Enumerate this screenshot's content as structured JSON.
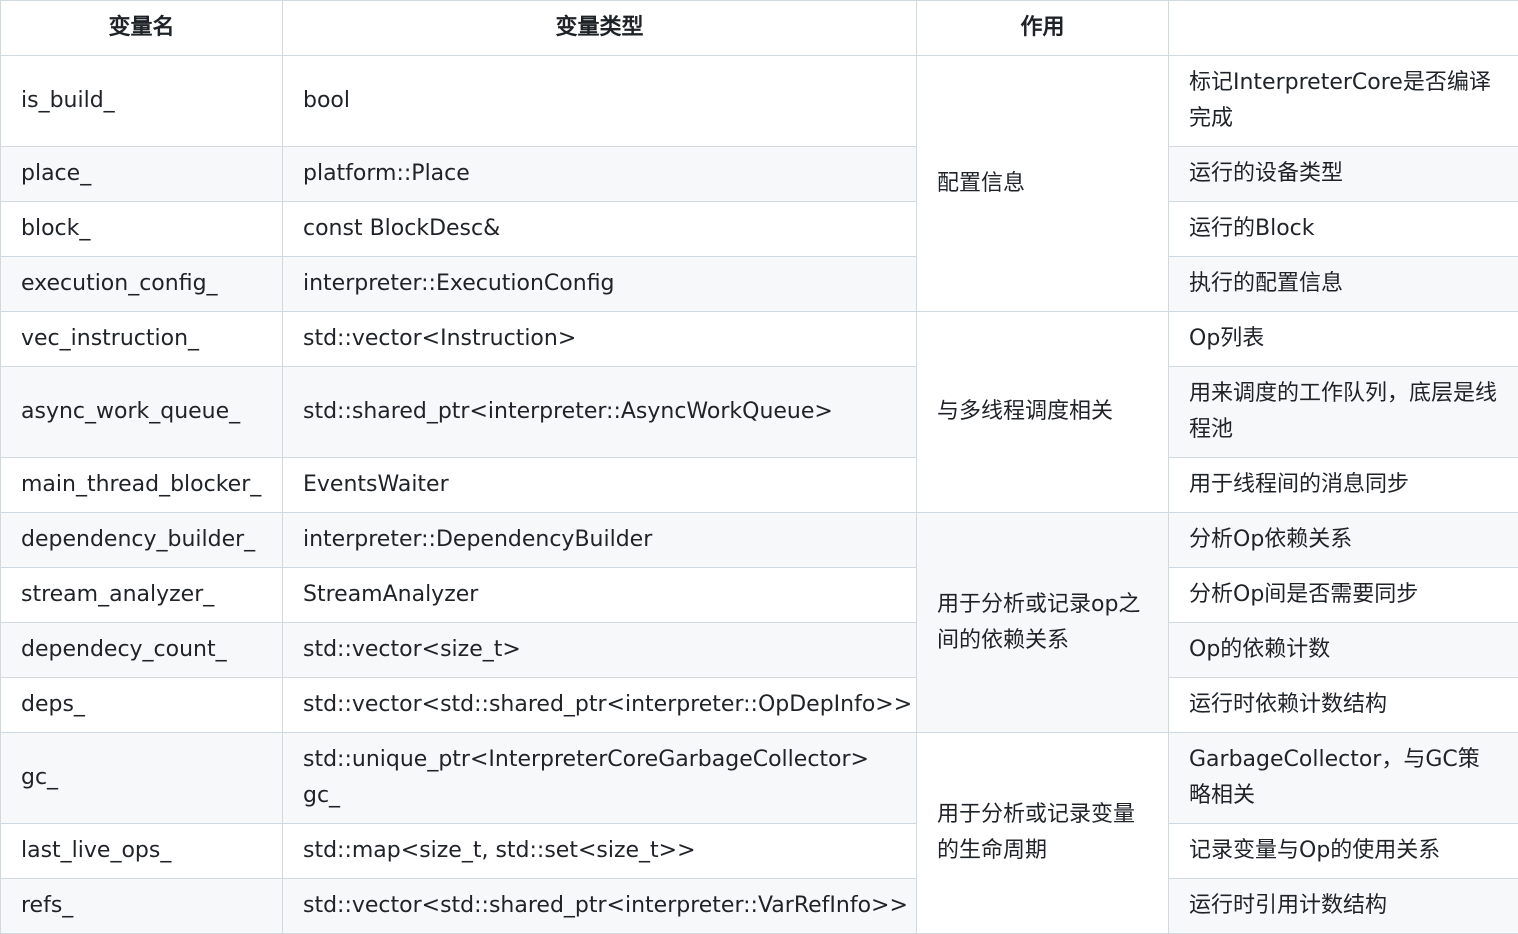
{
  "headers": [
    "变量名",
    "变量类型",
    "作用",
    ""
  ],
  "rows": [
    {
      "name": "is_build_",
      "type": "bool",
      "desc": "标记InterpreterCore是否编译完成"
    },
    {
      "name": "place_",
      "type": "platform::Place",
      "desc": "运行的设备类型"
    },
    {
      "name": "block_",
      "type": "const BlockDesc&",
      "desc": "运行的Block"
    },
    {
      "name": "execution_config_",
      "type": "interpreter::ExecutionConfig",
      "desc": "执行的配置信息"
    },
    {
      "name": "vec_instruction_",
      "type": "std::vector<Instruction>",
      "desc": "Op列表"
    },
    {
      "name": "async_work_queue_",
      "type": "std::shared_ptr<interpreter::AsyncWorkQueue>",
      "desc": "用来调度的工作队列，底层是线程池"
    },
    {
      "name": "main_thread_blocker_",
      "type": "EventsWaiter",
      "desc": "用于线程间的消息同步"
    },
    {
      "name": "dependency_builder_",
      "type": "interpreter::DependencyBuilder",
      "desc": "分析Op依赖关系"
    },
    {
      "name": "stream_analyzer_",
      "type": "StreamAnalyzer",
      "desc": "分析Op间是否需要同步"
    },
    {
      "name": "dependecy_count_",
      "type": "std::vector<size_t>",
      "desc": "Op的依赖计数"
    },
    {
      "name": "deps_",
      "type": "std::vector<std::shared_ptr<interpreter::OpDepInfo>>",
      "desc": "运行时依赖计数结构"
    },
    {
      "name": "gc_",
      "type": "std::unique_ptr<InterpreterCoreGarbageCollector> gc_",
      "desc": "GarbageCollector，与GC策略相关"
    },
    {
      "name": "last_live_ops_",
      "type": "std::map<size_t, std::set<size_t>>",
      "desc": "记录变量与Op的使用关系"
    },
    {
      "name": "refs_",
      "type": "std::vector<std::shared_ptr<interpreter::VarRefInfo>>",
      "desc": "运行时引用计数结构"
    }
  ],
  "groups": [
    "配置信息",
    "与多线程调度相关",
    "用于分析或记录op之间的依赖关系",
    "用于分析或记录变量的生命周期"
  ]
}
